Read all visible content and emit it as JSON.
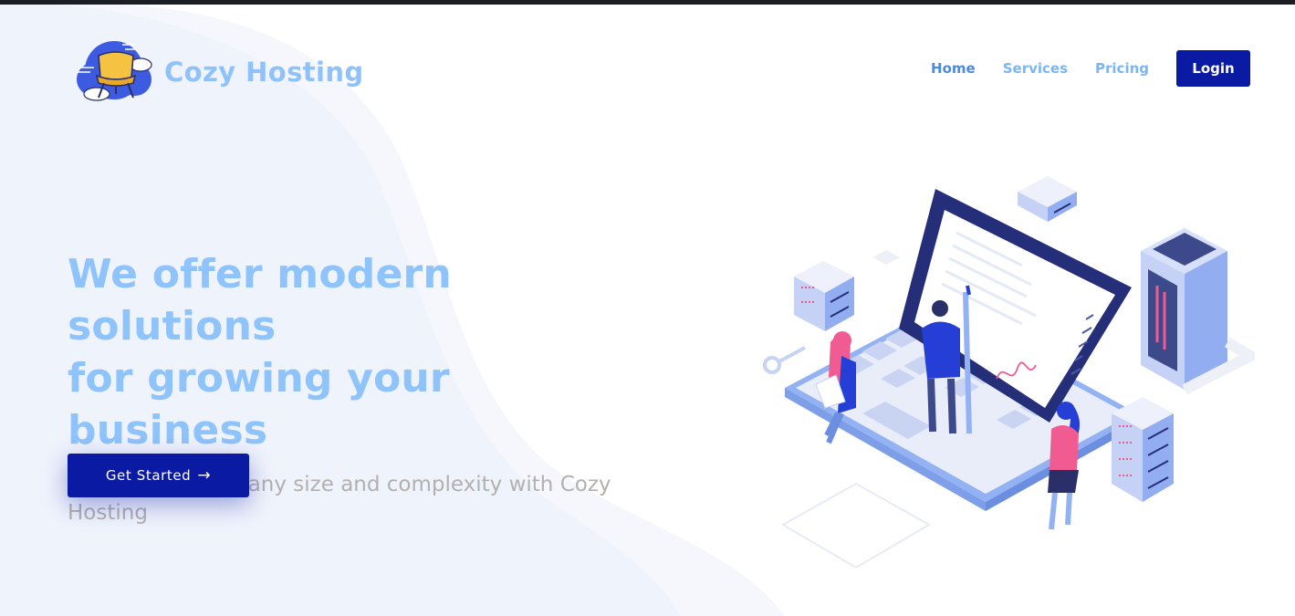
{
  "header": {
    "brand": "Cozy Hosting",
    "nav": {
      "home": "Home",
      "services": "Services",
      "pricing": "Pricing",
      "login": "Login"
    }
  },
  "hero": {
    "title_line1": "We offer modern solutions",
    "title_line2": "for growing your business",
    "subtitle": "Host a project of any size and complexity with Cozy Hosting",
    "cta_label": "Get Started",
    "cta_arrow": "→"
  },
  "icons": {
    "logo": "cloud-armchair-logo-icon",
    "cta": "arrow-right-icon"
  },
  "colors": {
    "brand": "#8fc1fb",
    "primary": "#0b1aa3",
    "nav_active": "#4c8ae0",
    "nav_link": "#7cb5f5",
    "subtitle": "#b3b0ae",
    "background_blob": "#eef2fc"
  }
}
